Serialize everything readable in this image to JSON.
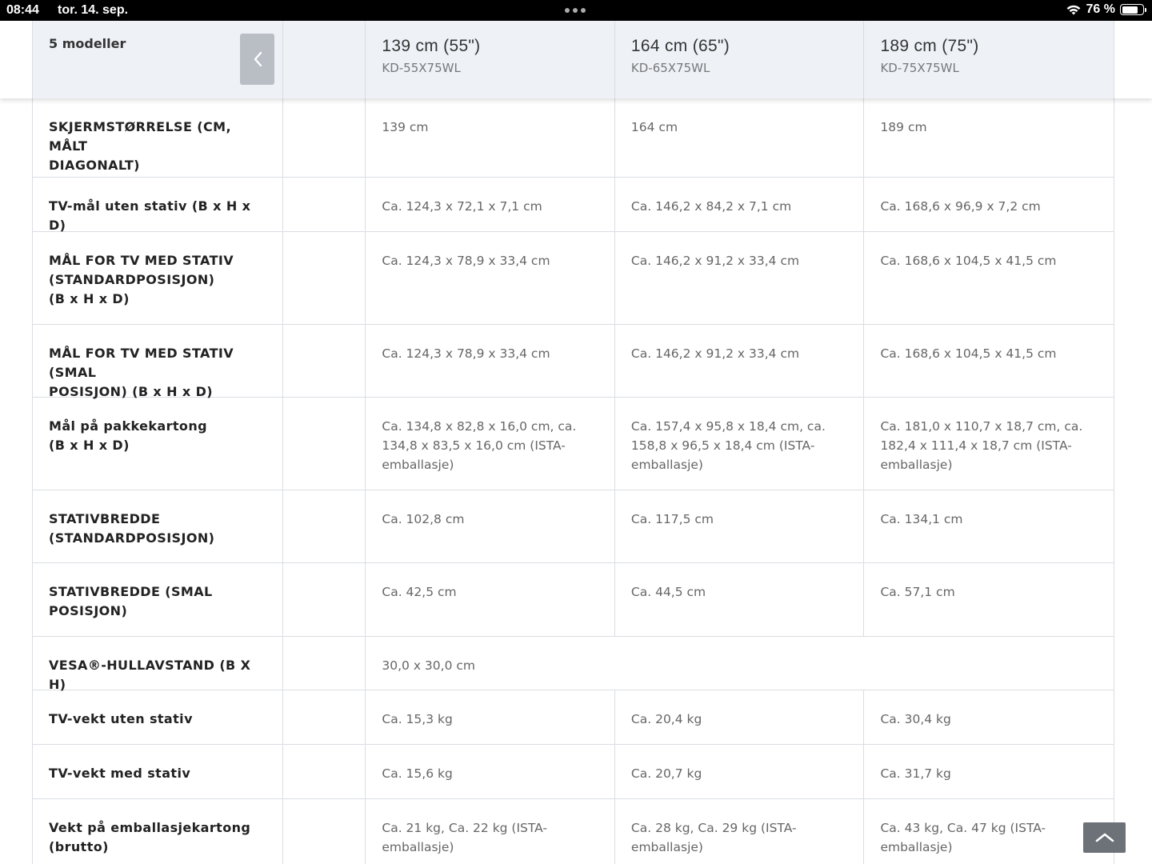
{
  "status_bar": {
    "time": "08:44",
    "date": "tor. 14. sep.",
    "battery": "76 %",
    "battery_level": 0.76
  },
  "header": {
    "models_count_label": "5 modeller",
    "prev_icon": "chevron-left-icon",
    "models": [
      {
        "size": "139 cm (55\")",
        "code": "KD-55X75WL"
      },
      {
        "size": "164 cm (65\")",
        "code": "KD-65X75WL"
      },
      {
        "size": "189 cm (75\")",
        "code": "KD-75X75WL"
      }
    ]
  },
  "rows": [
    {
      "label": "SKJERMSTØRRELSE (CM, MÅLT\nDIAGONALT)",
      "values": [
        "139 cm",
        "164 cm",
        "189 cm"
      ]
    },
    {
      "label": "TV-mål uten stativ (B x H x D)",
      "values": [
        "Ca. 124,3 x 72,1 x 7,1 cm",
        "Ca. 146,2 x 84,2 x 7,1 cm",
        "Ca. 168,6 x 96,9 x 7,2 cm"
      ]
    },
    {
      "label": "MÅL FOR TV MED STATIV\n(STANDARDPOSISJON)\n(B x H x D)",
      "values": [
        "Ca. 124,3 x 78,9 x 33,4 cm",
        "Ca. 146,2 x 91,2 x 33,4 cm",
        "Ca. 168,6 x 104,5 x 41,5 cm"
      ]
    },
    {
      "label": "MÅL FOR TV MED STATIV (SMAL\nPOSISJON) (B x H x D)",
      "values": [
        "Ca. 124,3 x 78,9 x 33,4 cm",
        "Ca. 146,2 x 91,2 x 33,4 cm",
        "Ca. 168,6 x 104,5 x 41,5 cm"
      ]
    },
    {
      "label": "Mål på pakkekartong\n(B x H x D)",
      "values": [
        "Ca. 134,8 x 82,8 x 16,0 cm, ca.\n134,8 x 83,5 x 16,0 cm (ISTA-\nemballasje)",
        "Ca. 157,4 x 95,8 x 18,4 cm, ca.\n158,8 x 96,5 x 18,4 cm (ISTA-\nemballasje)",
        "Ca. 181,0 x 110,7 x 18,7 cm, ca.\n182,4 x 111,4 x 18,7 cm (ISTA-\nemballasje)"
      ]
    },
    {
      "label": "STATIVBREDDE\n(STANDARDPOSISJON)",
      "values": [
        "Ca. 102,8 cm",
        "Ca. 117,5 cm",
        "Ca. 134,1 cm"
      ]
    },
    {
      "label": "STATIVBREDDE (SMAL\nPOSISJON)",
      "values": [
        "Ca. 42,5 cm",
        "Ca. 44,5 cm",
        "Ca. 57,1 cm"
      ]
    },
    {
      "label": "VESA®-HULLAVSTAND (B X H)",
      "span_value": "30,0 x 30,0 cm"
    },
    {
      "label": "TV-vekt uten stativ",
      "values": [
        "Ca. 15,3 kg",
        "Ca. 20,4 kg",
        "Ca. 30,4 kg"
      ]
    },
    {
      "label": "TV-vekt med stativ",
      "values": [
        "Ca. 15,6 kg",
        "Ca. 20,7 kg",
        "Ca. 31,7 kg"
      ]
    },
    {
      "label": "Vekt på emballasjekartong\n(brutto)",
      "values": [
        "Ca. 21 kg, Ca. 22 kg (ISTA-\nemballasje)",
        "Ca. 28 kg, Ca. 29 kg (ISTA-\nemballasje)",
        "Ca. 43 kg, Ca. 47 kg (ISTA-\nemballasje)"
      ]
    }
  ],
  "scroll_top_icon": "chevron-up-icon",
  "colors": {
    "header_bg": "#eef2f7",
    "border": "#d9dde2",
    "button_bg": "#b9bec5",
    "top_button_bg": "#6d7278"
  }
}
